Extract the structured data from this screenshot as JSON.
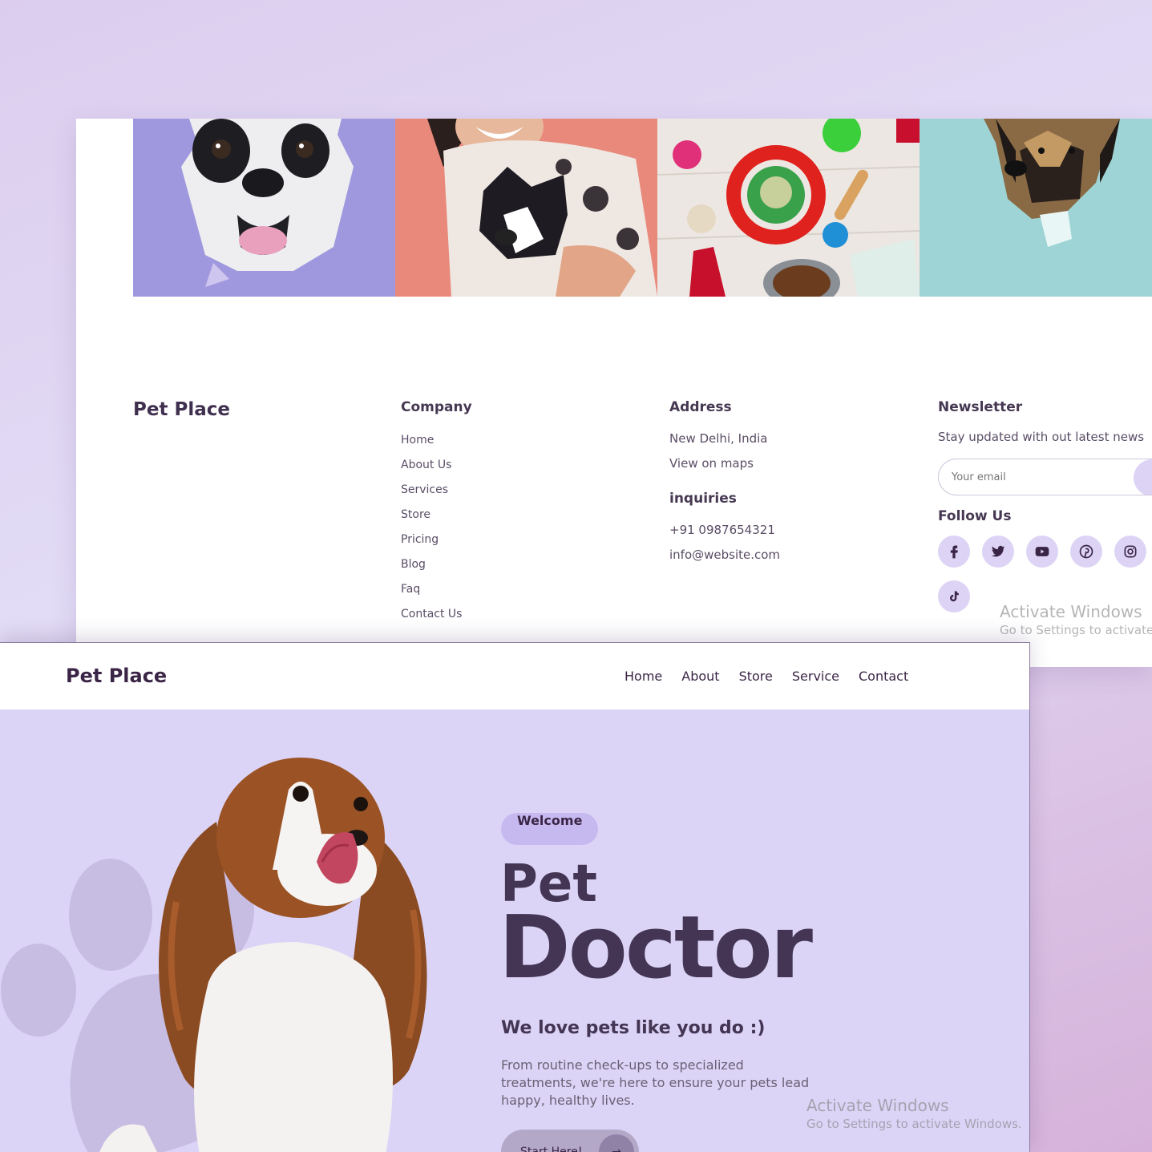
{
  "colors": {
    "background_top": "#dccdee",
    "background_bottom": "#d6b2da",
    "hero_bg": "#dcd4f6",
    "accent_light": "#ddd4f5",
    "badge_bg": "#c6b9ef",
    "text_dark": "#433553"
  },
  "footer_page": {
    "gallery": [
      {
        "icon": "bulldog-photo"
      },
      {
        "icon": "woman-holding-dog-photo"
      },
      {
        "icon": "pet-toys-photo"
      },
      {
        "icon": "shepherd-dog-photo"
      }
    ],
    "brand": "Pet Place",
    "company": {
      "heading": "Company",
      "links": [
        "Home",
        "About Us",
        "Services",
        "Store",
        "Pricing",
        "Blog",
        "Faq",
        "Contact Us"
      ]
    },
    "address": {
      "heading": "Address",
      "lines": [
        "New Delhi, India",
        "View on maps"
      ],
      "inquiries_heading": "inquiries",
      "contacts": [
        "+91 0987654321",
        "info@website.com"
      ]
    },
    "newsletter": {
      "heading": "Newsletter",
      "text": "Stay updated with out latest news",
      "placeholder": "Your email",
      "submit_icon": "arrow-right-icon",
      "submit_glyph": "→",
      "follow_heading": "Follow Us",
      "socials": [
        "facebook-icon",
        "twitter-icon",
        "youtube-icon",
        "pinterest-icon",
        "instagram-icon",
        "tiktok-icon"
      ]
    },
    "watermark": {
      "title": "Activate Windows",
      "subtitle": "Go to Settings to activate W"
    }
  },
  "hero_page": {
    "nav": {
      "brand": "Pet Place",
      "links": [
        "Home",
        "About",
        "Store",
        "Service",
        "Contact"
      ]
    },
    "hero": {
      "badge": "Welcome",
      "title_line1": "Pet",
      "title_line2": "Doctor",
      "tagline": "We love pets like you do :)",
      "description": "From routine check-ups to specialized treatments, we're here to ensure your pets lead happy, healthy lives.",
      "cta_label": "Start Here!",
      "cta_icon": "arrow-right-icon",
      "cta_glyph": "→",
      "image": "cavalier-spaniel-photo"
    },
    "watermark": {
      "title": "Activate Windows",
      "subtitle": "Go to Settings to activate Windows."
    }
  }
}
